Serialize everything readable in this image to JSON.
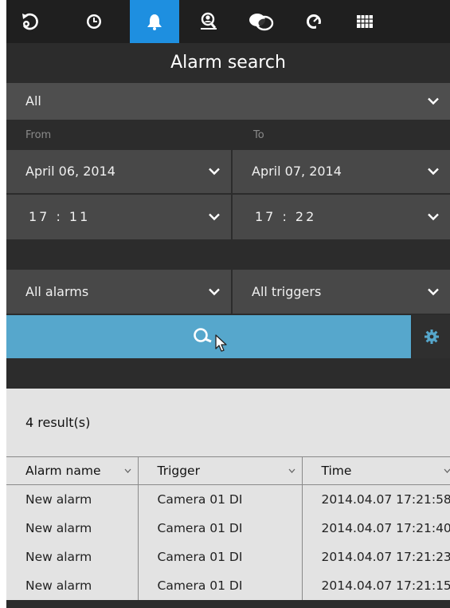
{
  "toolbar": {
    "icons": [
      "back-icon",
      "clock-icon",
      "bell-icon",
      "search-person-icon",
      "overlap-icon",
      "gauge-icon",
      "grid-icon"
    ],
    "active": "bell-icon",
    "active_color": "#1e8fe0"
  },
  "title": "Alarm search",
  "filter": {
    "value": "All"
  },
  "range": {
    "from_label": "From",
    "to_label": "To",
    "from_date": "April 06, 2014",
    "to_date": "April 07, 2014",
    "from_time": "17 : 11",
    "to_time": "17 : 22"
  },
  "selectors": {
    "alarms": "All alarms",
    "triggers": "All triggers"
  },
  "search": {
    "accent": "#56a7cc"
  },
  "results": {
    "count_text": "4 result(s)",
    "columns": [
      "Alarm name",
      "Trigger",
      "Time"
    ],
    "rows": [
      {
        "name": "New alarm",
        "trigger": "Camera 01 DI",
        "time": "2014.04.07 17:21:58"
      },
      {
        "name": "New alarm",
        "trigger": "Camera 01 DI",
        "time": "2014.04.07 17:21:40"
      },
      {
        "name": "New alarm",
        "trigger": "Camera 01 DI",
        "time": "2014.04.07 17:21:23"
      },
      {
        "name": "New alarm",
        "trigger": "Camera 01 DI",
        "time": "2014.04.07 17:21:15"
      }
    ]
  }
}
